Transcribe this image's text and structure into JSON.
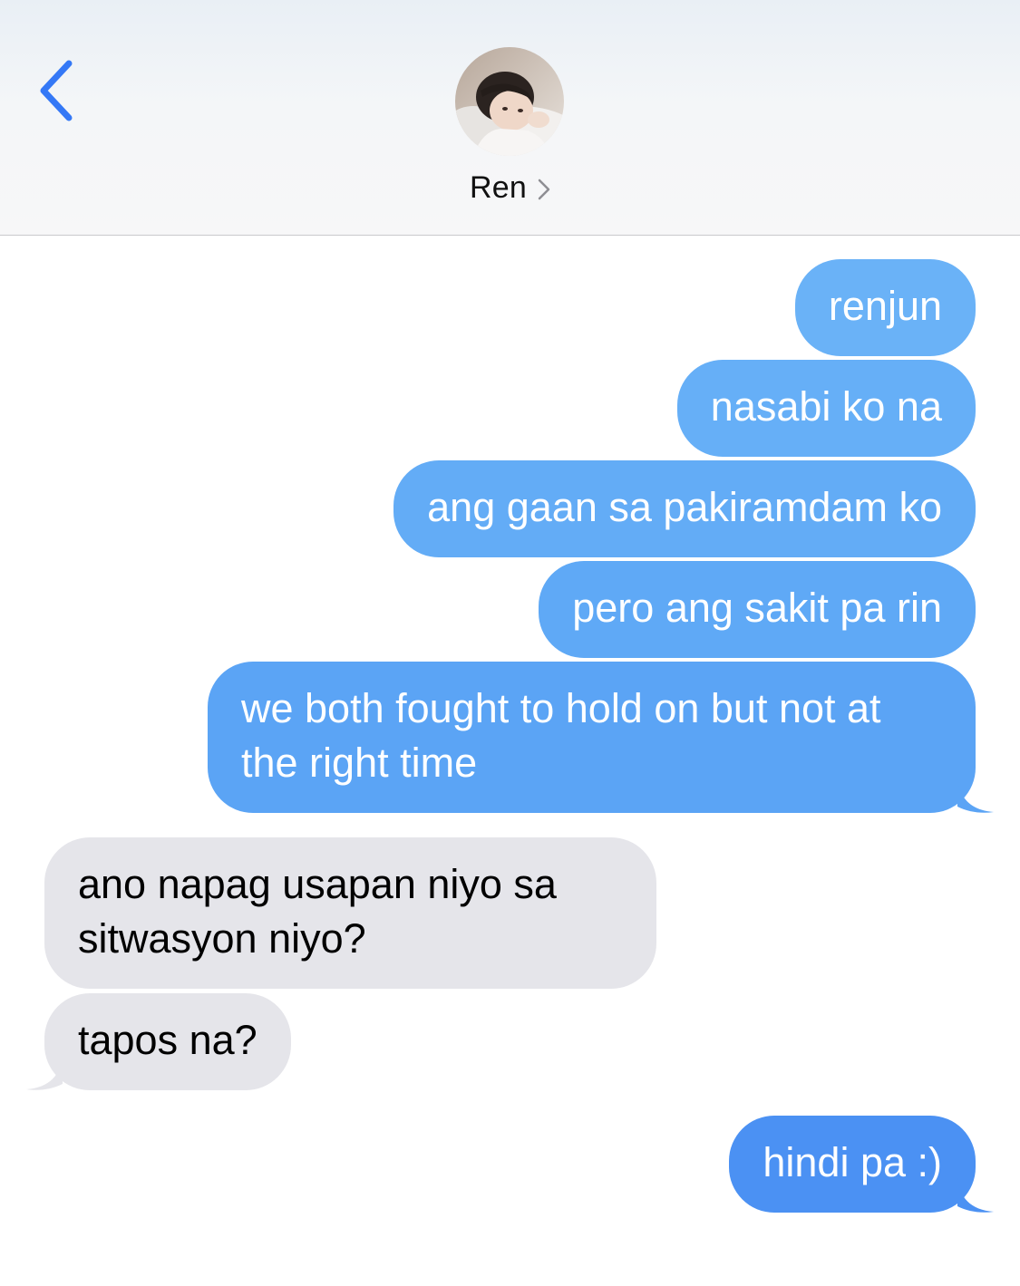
{
  "header": {
    "contact_name": "Ren",
    "avatar_icon": "contact-photo",
    "back_icon": "chevron-left-icon",
    "name_chevron_icon": "chevron-right-icon",
    "accent_color": "#3478f6"
  },
  "messages": [
    {
      "direction": "sent",
      "text": "renjun"
    },
    {
      "direction": "sent",
      "text": "nasabi ko na"
    },
    {
      "direction": "sent",
      "text": "ang gaan sa pakiramdam ko"
    },
    {
      "direction": "sent",
      "text": "pero ang sakit pa rin"
    },
    {
      "direction": "sent",
      "text": "we both fought to hold on but not at the right time"
    },
    {
      "direction": "received",
      "text": "ano napag usapan niyo sa sitwasyon niyo?"
    },
    {
      "direction": "received",
      "text": "tapos na?"
    },
    {
      "direction": "sent",
      "text": "hindi pa :)"
    }
  ],
  "colors": {
    "sent_bubble_top": "#6ab2f7",
    "sent_bubble_bottom": "#4b91f3",
    "received_bubble": "#e5e5ea"
  }
}
